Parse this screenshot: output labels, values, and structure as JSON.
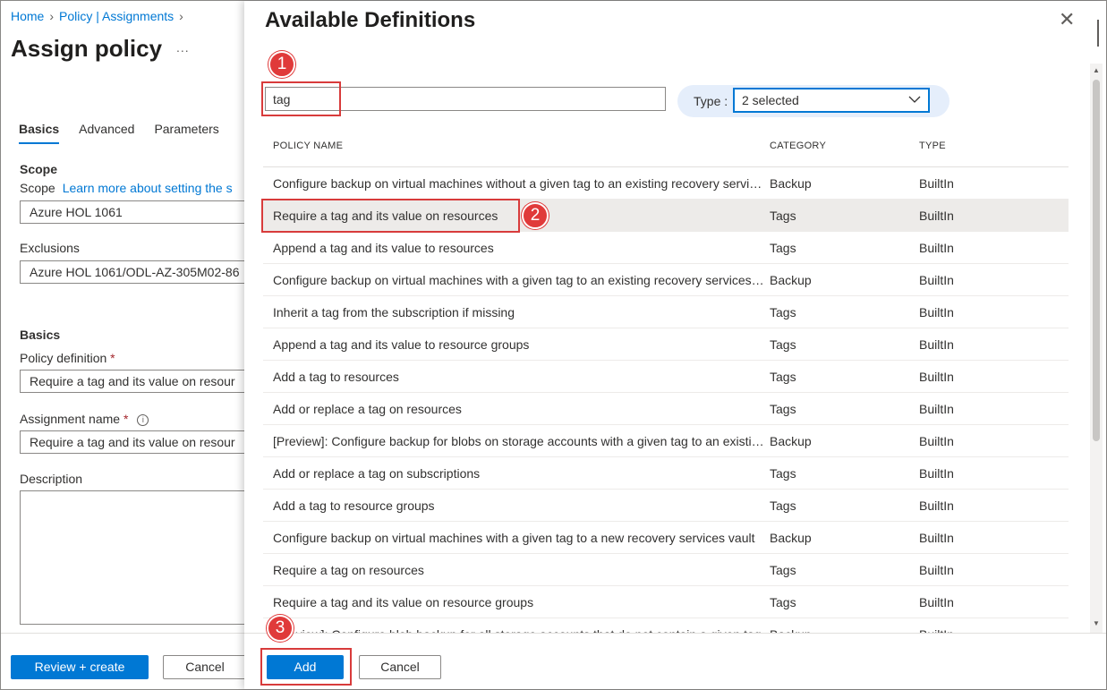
{
  "breadcrumb": {
    "home": "Home",
    "assignments": "Policy | Assignments"
  },
  "blade": {
    "title": "Assign policy",
    "more": "...",
    "tabs": [
      "Basics",
      "Advanced",
      "Parameters"
    ],
    "scope_heading": "Scope",
    "scope_label": "Scope",
    "scope_link": "Learn more about setting the s",
    "scope_value": "Azure HOL 1061",
    "exclusions_label": "Exclusions",
    "exclusions_value": "Azure HOL 1061/ODL-AZ-305M02-86",
    "basics_heading": "Basics",
    "policy_def_label": "Policy definition",
    "policy_def_value": "Require a tag and its value on resour",
    "assignment_name_label": "Assignment name",
    "assignment_name_value": "Require a tag and its value on resour",
    "required_mark": "*",
    "info_icon": "i",
    "description_label": "Description",
    "review_button": "Review + create",
    "cancel_button": "Cancel"
  },
  "panel": {
    "title": "Available Definitions",
    "close": "✕",
    "search_value": "tag",
    "type_label": "Type :",
    "type_value": "2 selected",
    "columns": {
      "name": "POLICY NAME",
      "category": "CATEGORY",
      "type": "TYPE"
    },
    "rows": [
      {
        "name": "Configure backup on virtual machines without a given tag to an existing recovery services vault in the same location",
        "category": "Backup",
        "type": "BuiltIn"
      },
      {
        "name": "Require a tag and its value on resources",
        "category": "Tags",
        "type": "BuiltIn"
      },
      {
        "name": "Append a tag and its value to resources",
        "category": "Tags",
        "type": "BuiltIn"
      },
      {
        "name": "Configure backup on virtual machines with a given tag to an existing recovery services vault in the same location",
        "category": "Backup",
        "type": "BuiltIn"
      },
      {
        "name": "Inherit a tag from the subscription if missing",
        "category": "Tags",
        "type": "BuiltIn"
      },
      {
        "name": "Append a tag and its value to resource groups",
        "category": "Tags",
        "type": "BuiltIn"
      },
      {
        "name": "Add a tag to resources",
        "category": "Tags",
        "type": "BuiltIn"
      },
      {
        "name": "Add or replace a tag on resources",
        "category": "Tags",
        "type": "BuiltIn"
      },
      {
        "name": "[Preview]: Configure backup for blobs on storage accounts with a given tag to an existing backup vault",
        "category": "Backup",
        "type": "BuiltIn"
      },
      {
        "name": "Add or replace a tag on subscriptions",
        "category": "Tags",
        "type": "BuiltIn"
      },
      {
        "name": "Add a tag to resource groups",
        "category": "Tags",
        "type": "BuiltIn"
      },
      {
        "name": "Configure backup on virtual machines with a given tag to a new recovery services vault",
        "category": "Backup",
        "type": "BuiltIn"
      },
      {
        "name": "Require a tag on resources",
        "category": "Tags",
        "type": "BuiltIn"
      },
      {
        "name": "Require a tag and its value on resource groups",
        "category": "Tags",
        "type": "BuiltIn"
      },
      {
        "name": "[Preview]: Configure blob backup for all storage accounts that do not contain a given tag",
        "category": "Backup",
        "type": "BuiltIn"
      }
    ],
    "add_button": "Add",
    "cancel_button": "Cancel"
  },
  "callouts": [
    "1",
    "2",
    "3"
  ],
  "colors": {
    "accent": "#0078d4",
    "callout": "#e03a3a",
    "selected_row": "#edebe9"
  }
}
